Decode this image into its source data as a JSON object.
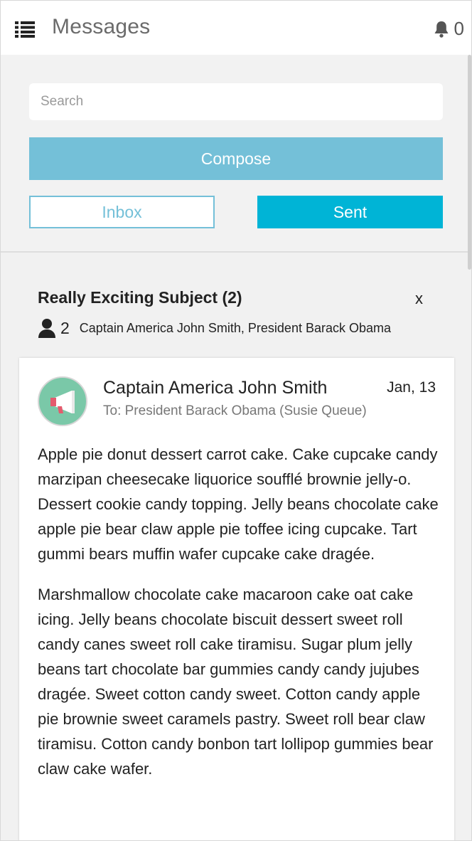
{
  "header": {
    "title": "Messages",
    "notification_count": "0",
    "menu_icon": "list-icon",
    "bell_icon": "bell-icon"
  },
  "controls": {
    "search_placeholder": "Search",
    "compose_label": "Compose",
    "inbox_label": "Inbox",
    "sent_label": "Sent"
  },
  "thread": {
    "subject": "Really Exciting Subject (2)",
    "close_label": "x",
    "participant_count": "2",
    "participants": "Captain America John Smith, President Barack Obama"
  },
  "message": {
    "sender": "Captain America John Smith",
    "date": "Jan, 13",
    "to": "To: President Barack Obama (Susie Queue)",
    "avatar_icon": "megaphone-icon",
    "paragraphs": [
      "Apple pie donut dessert carrot cake. Cake cupcake candy marzipan cheesecake liquorice soufflé brownie jelly-o. Dessert cookie candy topping. Jelly beans chocolate cake apple pie bear claw apple pie toffee icing cupcake. Tart gummi bears muffin wafer cupcake cake dragée.",
      "Marshmallow chocolate cake macaroon cake oat cake icing. Jelly beans chocolate biscuit dessert sweet roll candy canes sweet roll cake tiramisu. Sugar plum jelly beans tart chocolate bar gummies candy candy jujubes dragée. Sweet cotton candy sweet. Cotton candy apple pie brownie sweet caramels pastry. Sweet roll bear claw tiramisu. Cotton candy bonbon tart lollipop gummies bear claw cake wafer."
    ]
  },
  "colors": {
    "compose": "#74c0d8",
    "sent": "#00b4d6",
    "avatar": "#7ac8a8"
  }
}
